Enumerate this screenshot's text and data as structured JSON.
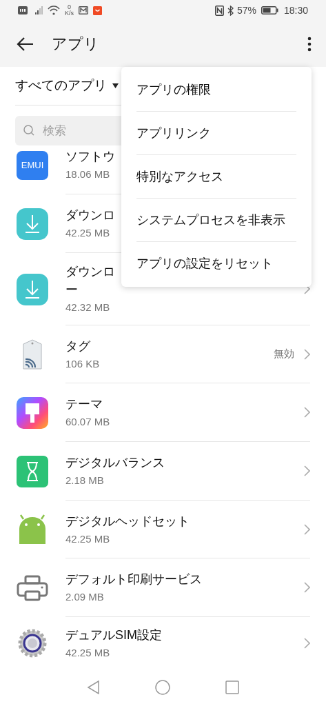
{
  "status_bar": {
    "speed_value": "0",
    "speed_unit": "K/s",
    "battery": "57%",
    "time": "18:30"
  },
  "app_bar": {
    "title": "アプリ"
  },
  "filter": {
    "label": "すべてのアプリ"
  },
  "search": {
    "placeholder": "検索"
  },
  "apps": [
    {
      "kind": "emui",
      "logo_text": "EMUI",
      "name": "ソフトウ",
      "size": "18.06 MB"
    },
    {
      "kind": "download",
      "name": "ダウンロ",
      "size": "42.25 MB"
    },
    {
      "kind": "download",
      "name": "ダウンロ",
      "name_cont": "ー",
      "size": "42.32 MB",
      "chevron": true
    },
    {
      "kind": "tag",
      "name": "タグ",
      "size": "106 KB",
      "status": "無効",
      "chevron": true
    },
    {
      "kind": "theme",
      "name": "テーマ",
      "size": "60.07 MB",
      "chevron": true
    },
    {
      "kind": "balance",
      "name": "デジタルバランス",
      "size": "2.18 MB",
      "chevron": true
    },
    {
      "kind": "android",
      "name": "デジタルヘッドセット",
      "size": "42.25 MB",
      "chevron": true
    },
    {
      "kind": "printer",
      "name": "デフォルト印刷サービス",
      "size": "2.09 MB",
      "chevron": true
    },
    {
      "kind": "gear",
      "name": "デュアルSIM設定",
      "size": "42.25 MB",
      "chevron": true
    }
  ],
  "menu": [
    "アプリの権限",
    "アプリリンク",
    "特別なアクセス",
    "システムプロセスを非表示",
    "アプリの設定をリセット"
  ]
}
